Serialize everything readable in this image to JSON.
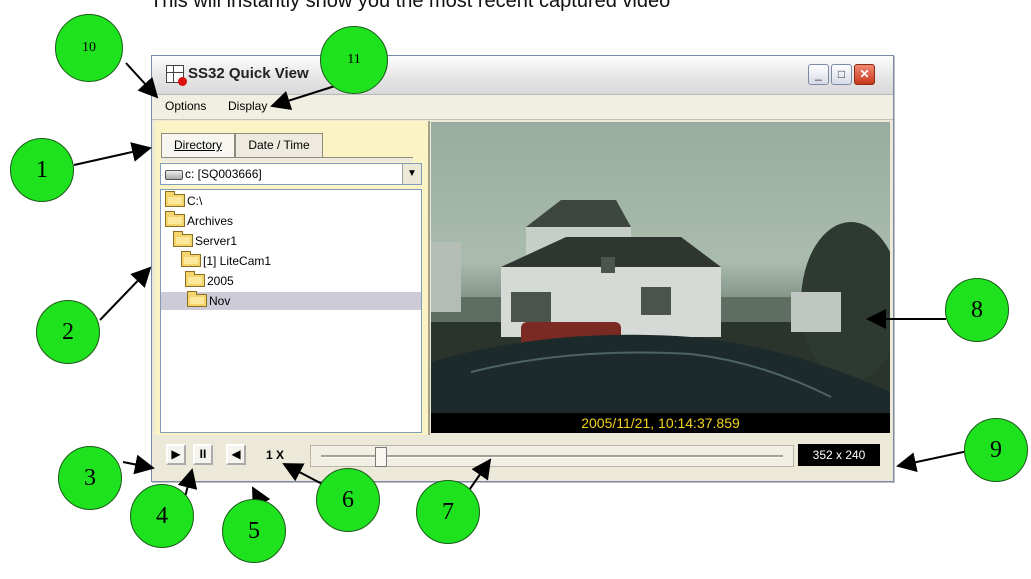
{
  "caption": "This will instantly show you the most recent captured video",
  "window": {
    "title": "SS32 Quick View",
    "controls": {
      "minimize": "_",
      "maximize": "□",
      "close": "✕"
    }
  },
  "menu": {
    "options": "Options",
    "display": "Display"
  },
  "left_pane": {
    "tabs": [
      "Directory",
      "Date / Time"
    ],
    "active_tab": "Directory",
    "drive": {
      "label": "c: [SQ003666]",
      "icon": "drive-icon"
    },
    "tree": [
      {
        "label": "C:\\",
        "level": 0,
        "selected": false
      },
      {
        "label": "Archives",
        "level": 0,
        "selected": false
      },
      {
        "label": "Server1",
        "level": 1,
        "selected": false
      },
      {
        "label": "[1] LiteCam1",
        "level": 2,
        "selected": false
      },
      {
        "label": "2005",
        "level": 3,
        "selected": false
      },
      {
        "label": "Nov",
        "level": 3,
        "selected": true
      }
    ]
  },
  "video": {
    "timestamp": "2005/11/21, 10:14:37.859",
    "colors": {
      "timestamp_text": "#f3d21b",
      "sky": "#a9bcae"
    }
  },
  "controls": {
    "play": "▶",
    "pause": "II",
    "step_back": "◀",
    "speed": "1 X",
    "slider_position": 0.12,
    "resolution": "352 x 240"
  },
  "callouts": [
    "1",
    "2",
    "3",
    "4",
    "5",
    "6",
    "7",
    "8",
    "9",
    "10",
    "11"
  ],
  "callout_color": "#1de21d"
}
